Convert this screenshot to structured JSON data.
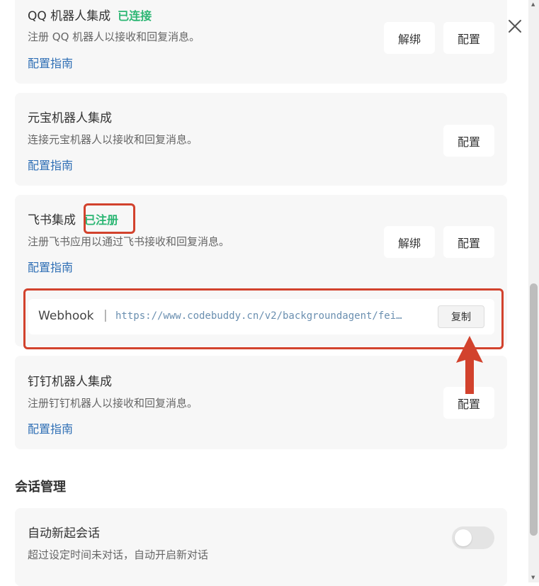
{
  "integrations": {
    "qq": {
      "title": "QQ 机器人集成",
      "status": "已连接",
      "description": "注册 QQ 机器人以接收和回复消息。",
      "guide": "配置指南",
      "unbind": "解绑",
      "configure": "配置"
    },
    "yuanbao": {
      "title": "元宝机器人集成",
      "description": "连接元宝机器人以接收和回复消息。",
      "guide": "配置指南",
      "configure": "配置"
    },
    "feishu": {
      "title": "飞书集成",
      "status": "已注册",
      "description": "注册飞书应用以通过飞书接收和回复消息。",
      "guide": "配置指南",
      "unbind": "解绑",
      "configure": "配置",
      "webhook": {
        "label": "Webhook",
        "separator": "|",
        "url": "https://www.codebuddy.cn/v2/backgroundagent/fei…",
        "copy": "复制"
      }
    },
    "dingtalk": {
      "title": "钉钉机器人集成",
      "description": "注册钉钉机器人以接收和回复消息。",
      "guide": "配置指南",
      "configure": "配置"
    }
  },
  "session": {
    "section_title": "会话管理",
    "auto_new": {
      "title": "自动新起会话",
      "description": "超过设定时间未对话，自动开启新对话",
      "enabled": false
    }
  },
  "colors": {
    "status_green": "#2bb673",
    "link_blue": "#2f6fb5",
    "highlight_red": "#d2422d",
    "card_bg": "#f7f7f7"
  },
  "icons": {
    "close": "close-icon",
    "annotation_arrow": "arrow-up-icon"
  }
}
